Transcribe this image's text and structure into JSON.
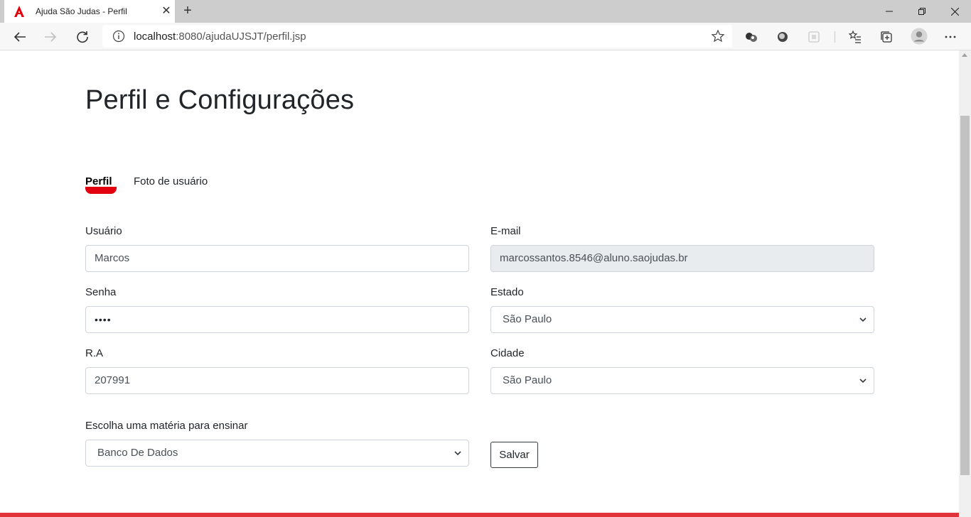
{
  "browser": {
    "tab_title": "Ajuda São Judas - Perfil",
    "address_host": "localhost",
    "address_rest": ":8080/ajudaUJSJT/perfil.jsp",
    "accent_color": "#e3000f"
  },
  "page": {
    "title": "Perfil e Configurações",
    "tabs": [
      {
        "label": "Perfil",
        "active": true
      },
      {
        "label": "Foto de usuário",
        "active": false
      }
    ],
    "form": {
      "usuario_label": "Usuário",
      "usuario_value": "Marcos",
      "email_label": "E-mail",
      "email_value": "marcossantos.8546@aluno.saojudas.br",
      "senha_label": "Senha",
      "senha_value": "••••",
      "estado_label": "Estado",
      "estado_value": "São Paulo",
      "ra_label": "R.A",
      "ra_value": "207991",
      "cidade_label": "Cidade",
      "cidade_value": "São Paulo",
      "materia_label": "Escolha uma matéria para ensinar",
      "materia_value": "Banco De Dados",
      "save_label": "Salvar"
    },
    "footer_color": "#e0343a"
  }
}
